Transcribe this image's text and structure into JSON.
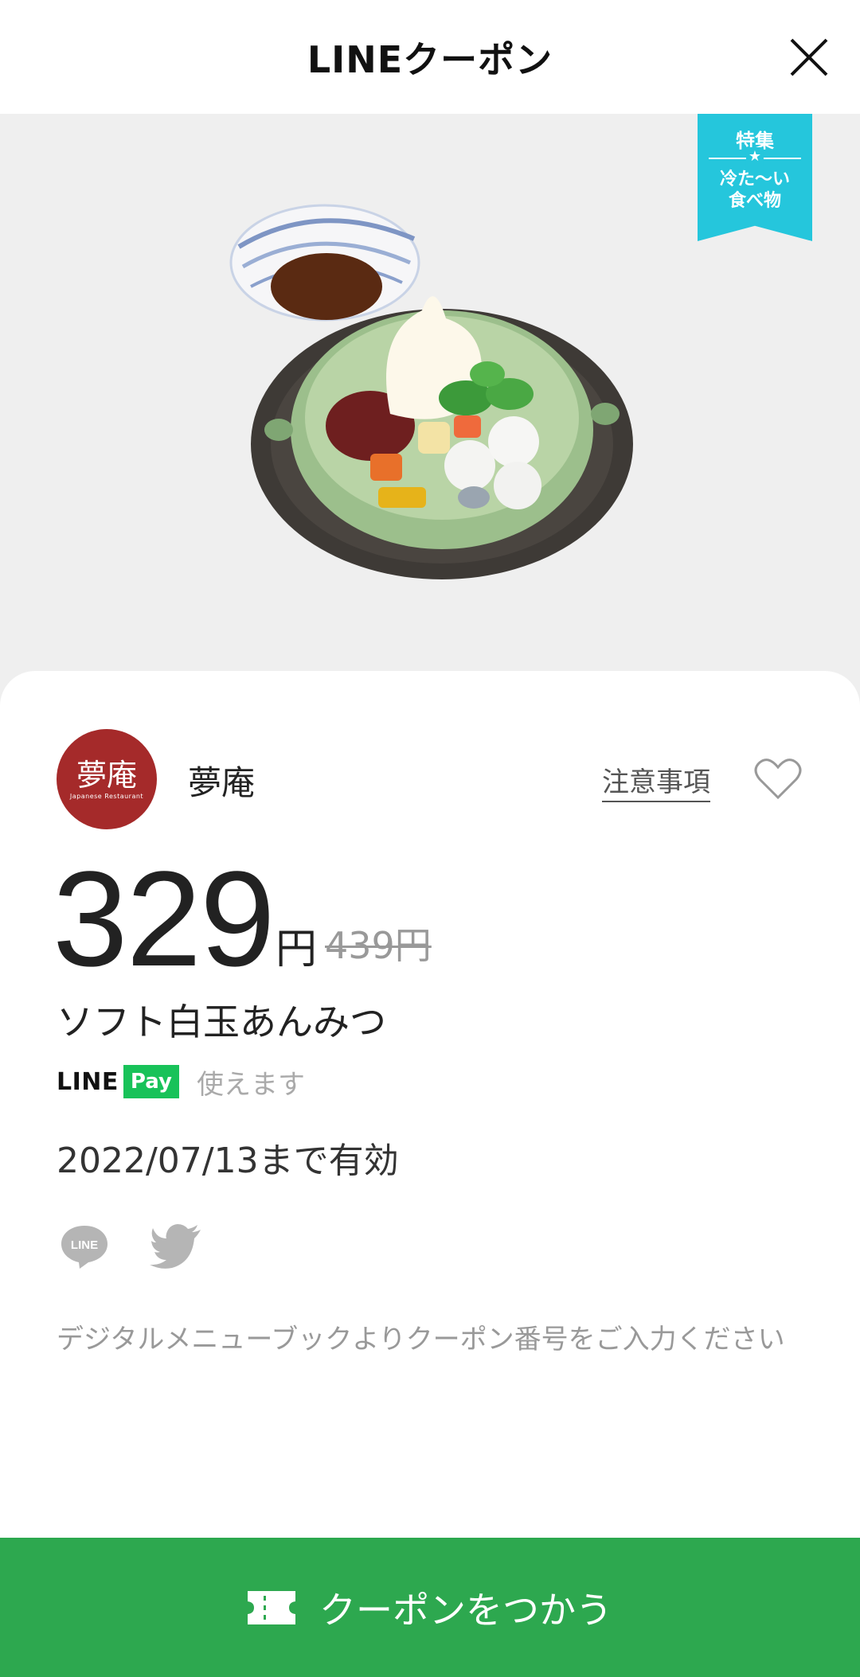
{
  "header": {
    "title": "LINEクーポン",
    "close_icon": "close-icon"
  },
  "badge": {
    "line1": "特集",
    "star": "★",
    "line2": "冷た〜い",
    "line3": "食べ物",
    "color": "#25c6dc"
  },
  "shop": {
    "name": "夢庵",
    "logo_text": "夢庵",
    "logo_sub": "Japanese Restaurant",
    "logo_color": "#a52a2a"
  },
  "notes_link": "注意事項",
  "price": {
    "value": "329",
    "currency": "円",
    "original": "439円"
  },
  "product_name": "ソフト白玉あんみつ",
  "line_pay": {
    "line": "LINE",
    "pay": "Pay",
    "usable": "使えます",
    "color": "#18c259"
  },
  "validity": "2022/07/13まで有効",
  "share": {
    "line_icon": "line-share-icon",
    "twitter_icon": "twitter-share-icon"
  },
  "note": "デジタルメニューブックよりクーポン番号をご入力ください",
  "cta": {
    "label": "クーポンをつかう",
    "icon": "ticket-icon",
    "color": "#2da84f"
  }
}
